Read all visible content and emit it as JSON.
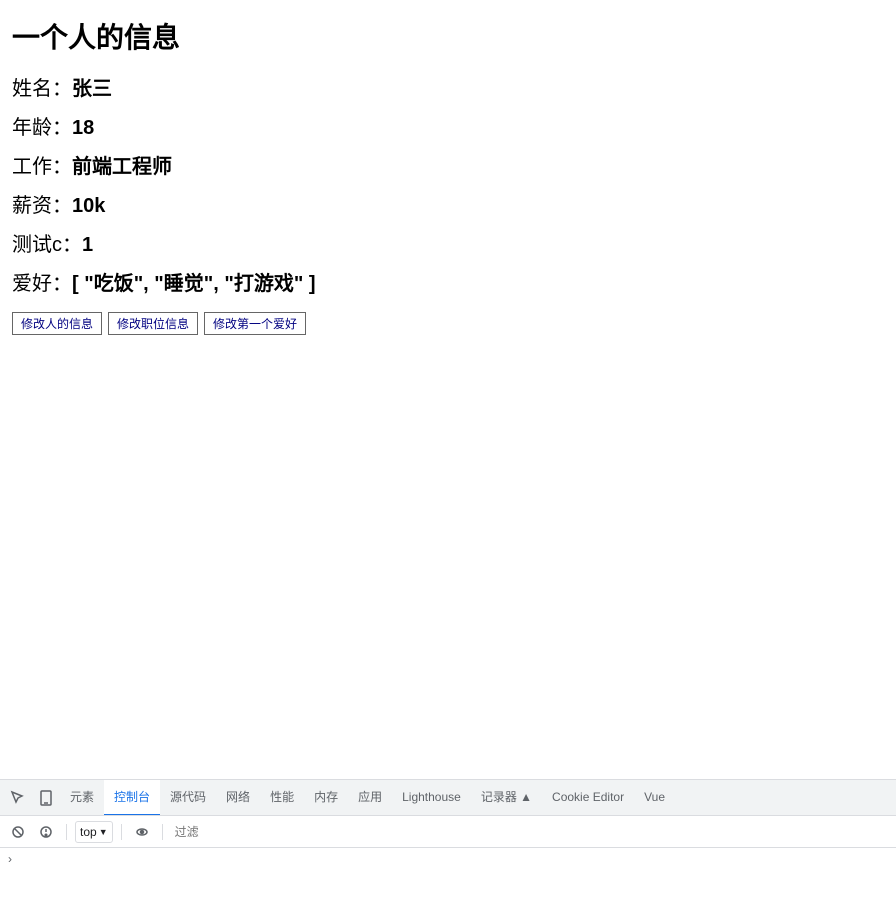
{
  "page": {
    "title": "一个人的信息"
  },
  "person": {
    "name_label": "姓名：",
    "name_value": "张三",
    "age_label": "年龄：",
    "age_value": "18",
    "job_label": "工作：",
    "job_value": "前端工程师",
    "salary_label": "薪资：",
    "salary_value": "10k",
    "test_label": "测试c：",
    "test_value": "1",
    "hobby_label": "爱好：",
    "hobby_value": "[ \"吃饭\", \"睡觉\", \"打游戏\" ]"
  },
  "buttons": {
    "edit_info": "修改人的信息",
    "edit_job": "修改职位信息",
    "edit_hobby": "修改第一个爱好"
  },
  "devtools": {
    "tabs": [
      "元素",
      "控制台",
      "源代码",
      "网络",
      "性能",
      "内存",
      "应用",
      "Lighthouse",
      "记录器 ▲",
      "Cookie Editor",
      "Vue"
    ],
    "active_tab": "控制台",
    "toolbar": {
      "top_label": "top",
      "filter_placeholder": "过滤"
    }
  }
}
